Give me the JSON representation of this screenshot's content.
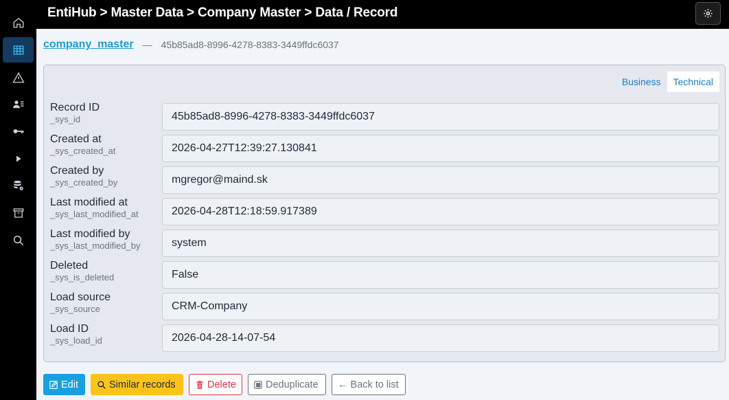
{
  "header": {
    "breadcrumb": "EntiHub > Master Data > Company Master > Data / Record"
  },
  "sidebar": {
    "items": [
      {
        "icon": "home-icon",
        "active": false
      },
      {
        "icon": "table-icon",
        "active": true
      },
      {
        "icon": "warning-icon",
        "active": false
      },
      {
        "icon": "users-list-icon",
        "active": false
      },
      {
        "icon": "key-icon",
        "active": false
      },
      {
        "icon": "play-icon",
        "active": false
      },
      {
        "icon": "database-settings-icon",
        "active": false
      },
      {
        "icon": "archive-icon",
        "active": false
      },
      {
        "icon": "search-icon",
        "active": false
      }
    ]
  },
  "record": {
    "entity": "company_master",
    "separator": "—",
    "id": "45b85ad8-8996-4278-8383-3449ffdc6037"
  },
  "tabs": [
    {
      "label": "Business",
      "active": false
    },
    {
      "label": "Technical",
      "active": true
    }
  ],
  "fields": [
    {
      "label": "Record ID",
      "key": "_sys_id",
      "value": "45b85ad8-8996-4278-8383-3449ffdc6037"
    },
    {
      "label": "Created at",
      "key": "_sys_created_at",
      "value": "2026-04-27T12:39:27.130841"
    },
    {
      "label": "Created by",
      "key": "_sys_created_by",
      "value": "mgregor@maind.sk"
    },
    {
      "label": "Last modified at",
      "key": "_sys_last_modified_at",
      "value": "2026-04-28T12:18:59.917389"
    },
    {
      "label": "Last modified by",
      "key": "_sys_last_modified_by",
      "value": "system"
    },
    {
      "label": "Deleted",
      "key": "_sys_is_deleted",
      "value": "False"
    },
    {
      "label": "Load source",
      "key": "_sys_source",
      "value": "CRM-Company"
    },
    {
      "label": "Load ID",
      "key": "_sys_load_id",
      "value": "2026-04-28-14-07-54"
    }
  ],
  "actions": {
    "edit": "Edit",
    "similar": "Similar records",
    "delete": "Delete",
    "deduplicate": "Deduplicate",
    "back": "← Back to list"
  },
  "colors": {
    "accent": "#1a9fe0",
    "warning": "#fcc419",
    "danger": "#dc3545",
    "sidebar_active": "#143a5f"
  }
}
